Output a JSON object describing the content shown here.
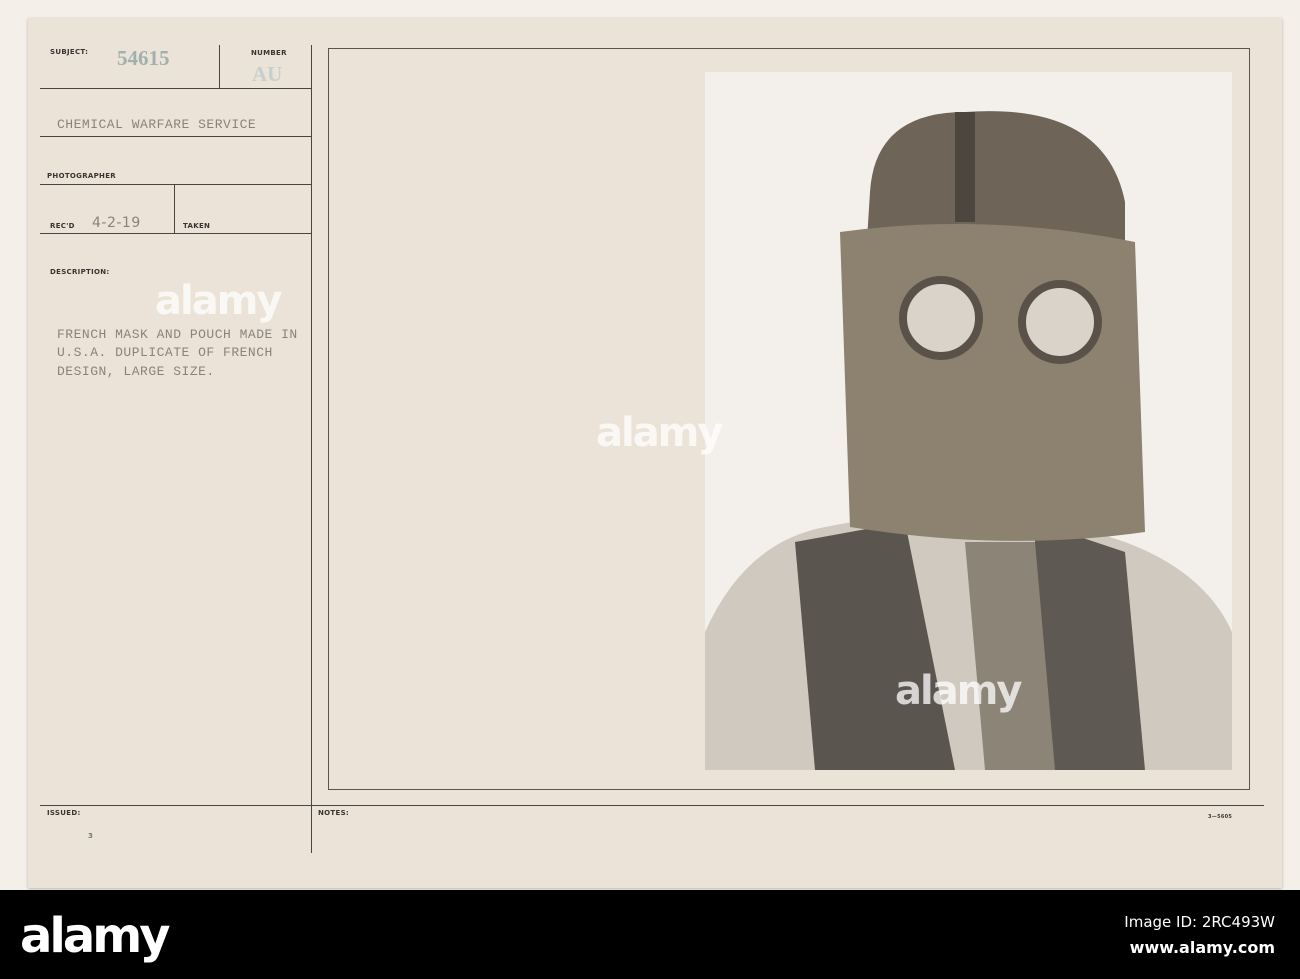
{
  "card": {
    "subject_label": "SUBJECT:",
    "subject_number": "54615",
    "number_label": "NUMBER",
    "number_value": "AU",
    "service": "CHEMICAL WARFARE SERVICE",
    "photographer_label": "PHOTOGRAPHER",
    "recd_label": "REC'D",
    "recd_value": "4-2-19",
    "taken_label": "TAKEN",
    "description_label": "DESCRIPTION:",
    "description_lines": [
      "FRENCH MASK AND POUCH MADE IN",
      "U.S.A. DUPLICATE OF FRENCH",
      "DESIGN, LARGE SIZE."
    ],
    "issued_label": "ISSUED:",
    "issued_mark": "3",
    "notes_label": "NOTES:",
    "form_number": "3—5605"
  },
  "watermark": "alamy",
  "footer": {
    "logo": "alamy",
    "image_id": "Image ID: 2RC493W",
    "url": "www.alamy.com"
  }
}
